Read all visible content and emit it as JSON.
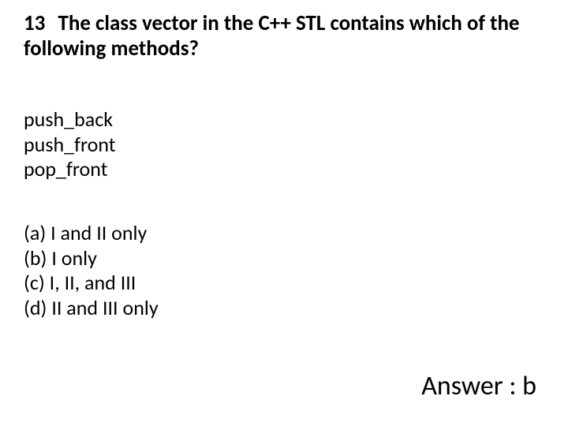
{
  "question": {
    "number": "13",
    "text": "The class vector in the C++ STL contains which of the following methods?"
  },
  "methods": [
    "push_back",
    "push_front",
    "pop_front"
  ],
  "options": [
    {
      "label": "(a)",
      "text": "I and II only"
    },
    {
      "label": "(b)",
      "text": "I only"
    },
    {
      "label": "(c)",
      "text": "I, II, and III"
    },
    {
      "label": "(d)",
      "text": "II and III only"
    }
  ],
  "answer": {
    "label": "Answer",
    "separator": " : ",
    "value": "b"
  }
}
